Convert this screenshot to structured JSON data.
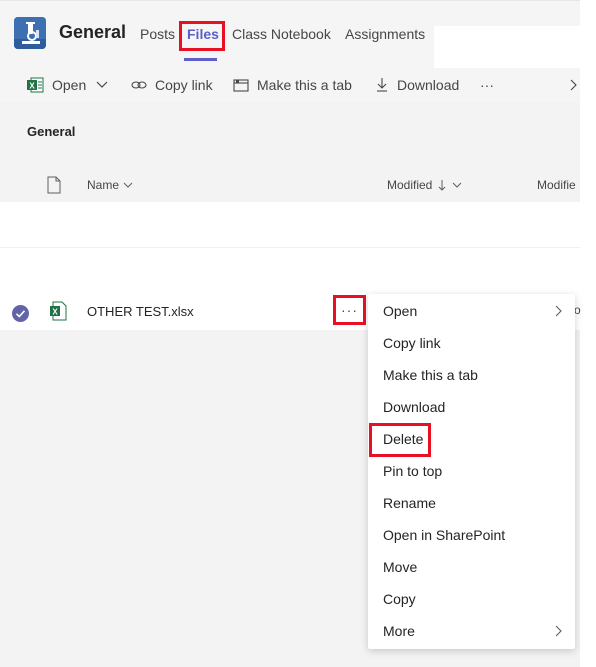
{
  "header": {
    "channel_name": "General",
    "tabs": [
      {
        "label": "Posts"
      },
      {
        "label": "Files"
      },
      {
        "label": "Class Notebook"
      },
      {
        "label": "Assignments"
      }
    ],
    "active_tab": "Files"
  },
  "toolbar": {
    "open_label": "Open",
    "copy_link_label": "Copy link",
    "make_tab_label": "Make this a tab",
    "download_label": "Download",
    "more_label": "···"
  },
  "library": {
    "section_title": "General",
    "columns": {
      "name": "Name",
      "modified": "Modified",
      "modified2": "Modifie"
    }
  },
  "files": [
    {
      "name": "OTHER TEST.xlsx",
      "selected": true,
      "more_label": "···",
      "edge_text": "o"
    }
  ],
  "context_menu": {
    "items": [
      {
        "label": "Open",
        "submenu": true
      },
      {
        "label": "Copy link"
      },
      {
        "label": "Make this a tab"
      },
      {
        "label": "Download"
      },
      {
        "label": "Delete"
      },
      {
        "label": "Pin to top"
      },
      {
        "label": "Rename"
      },
      {
        "label": "Open in SharePoint"
      },
      {
        "label": "Move"
      },
      {
        "label": "Copy"
      },
      {
        "label": "More",
        "submenu": true
      }
    ]
  },
  "colors": {
    "accent": "#5b5fc7",
    "highlight": "#e81123",
    "excel": "#217346"
  },
  "icons": [
    "science-team-icon",
    "excel-icon",
    "link-icon",
    "tab-icon",
    "download-icon",
    "document-icon",
    "check-circle-icon",
    "chevron-right-icon",
    "chevron-down-icon"
  ]
}
